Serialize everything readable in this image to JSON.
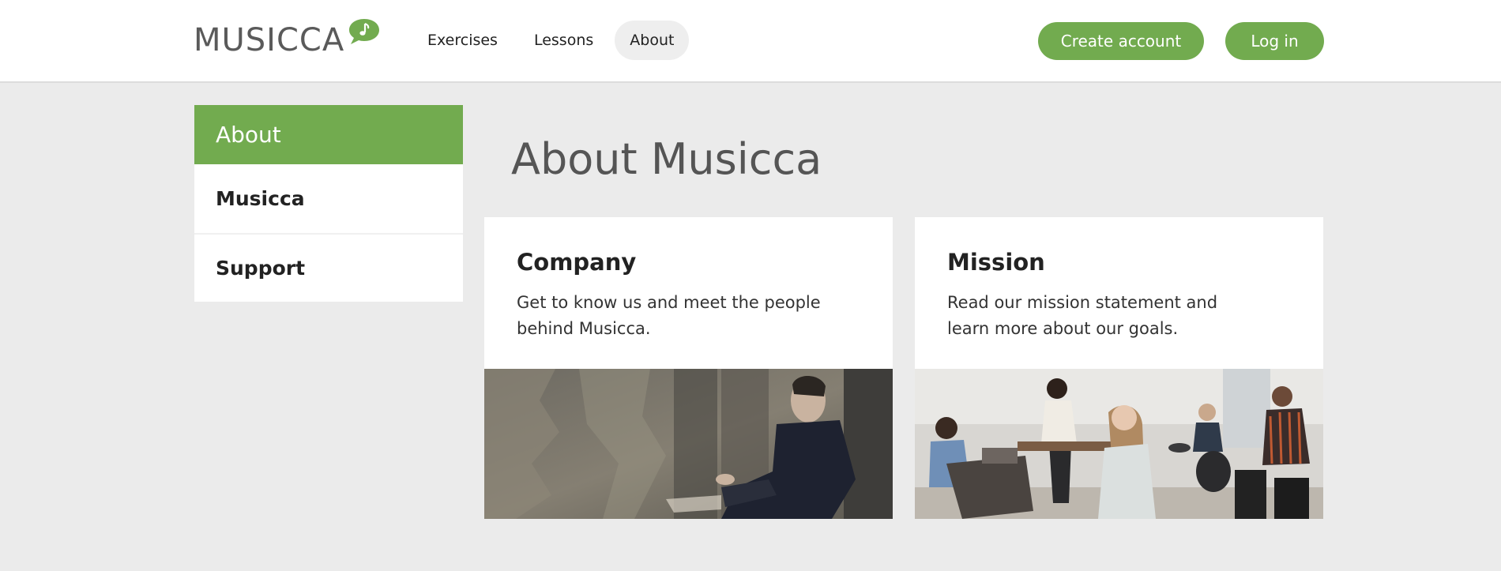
{
  "header": {
    "logo_text": "MUSICCA",
    "nav": [
      {
        "label": "Exercises",
        "active": false
      },
      {
        "label": "Lessons",
        "active": false
      },
      {
        "label": "About",
        "active": true
      }
    ],
    "create_account": "Create account",
    "log_in": "Log in"
  },
  "sidebar": {
    "heading": "About",
    "items": [
      {
        "label": "Musicca"
      },
      {
        "label": "Support"
      }
    ]
  },
  "main": {
    "title": "About Musicca",
    "cards": [
      {
        "title": "Company",
        "description": "Get to know us and meet the people behind Musicca."
      },
      {
        "title": "Mission",
        "description": "Read our mission statement and learn more about our goals."
      }
    ]
  },
  "colors": {
    "accent": "#72ab4f",
    "background": "#ebebeb",
    "header_bg": "#ffffff",
    "text": "#222222"
  }
}
